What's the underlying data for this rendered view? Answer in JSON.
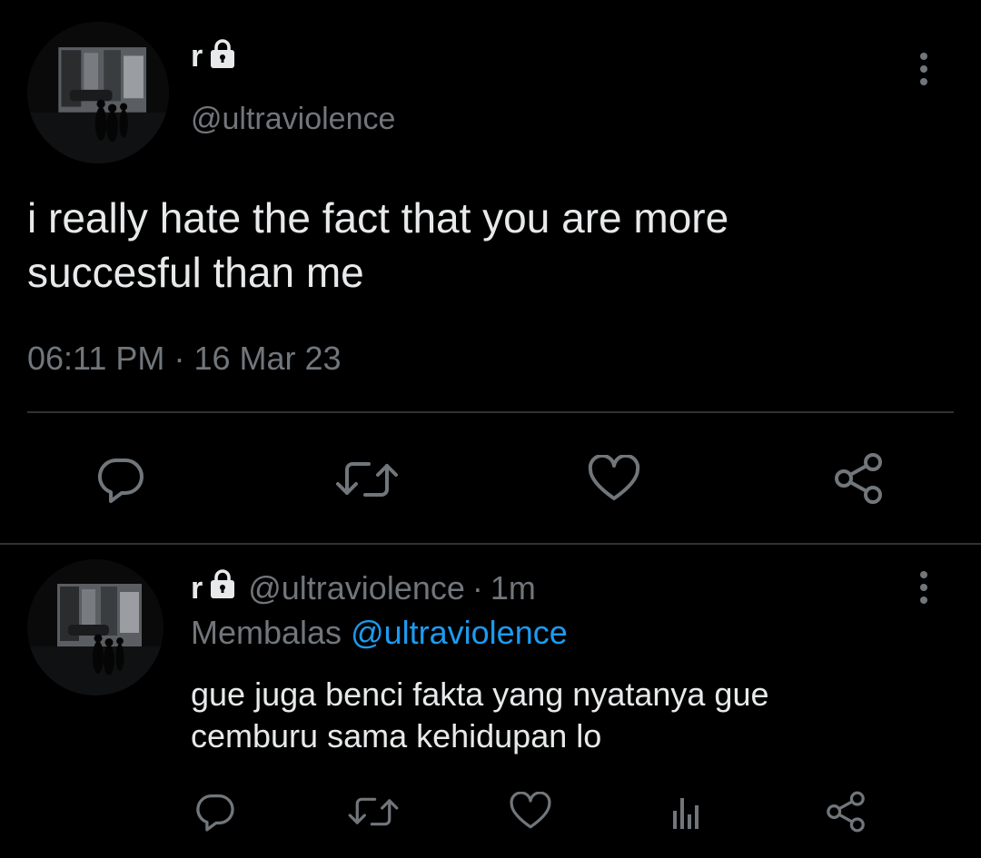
{
  "tweet": {
    "display_name": "r",
    "handle": "@ultraviolence",
    "text": "i really hate the fact that you are more\nsuccesful than me",
    "time": "06:11 PM",
    "separator": "·",
    "date": "16 Mar 23",
    "actions": [
      "reply-icon",
      "retweet-icon",
      "like-icon",
      "share-icon"
    ]
  },
  "reply": {
    "display_name": "r",
    "handle": "@ultraviolence",
    "separator": "·",
    "time_ago": "1m",
    "replying_prefix": "Membalas",
    "replying_to": "@ultraviolence",
    "text": "gue juga benci fakta yang nyatanya gue\ncemburu sama kehidupan lo",
    "actions": [
      "reply-icon",
      "retweet-icon",
      "like-icon",
      "views-icon",
      "share-icon"
    ]
  },
  "colors": {
    "background": "#000000",
    "text_primary": "#e7e9ea",
    "text_secondary": "#71767b",
    "link": "#1d9bf0",
    "divider": "#2f3336"
  }
}
